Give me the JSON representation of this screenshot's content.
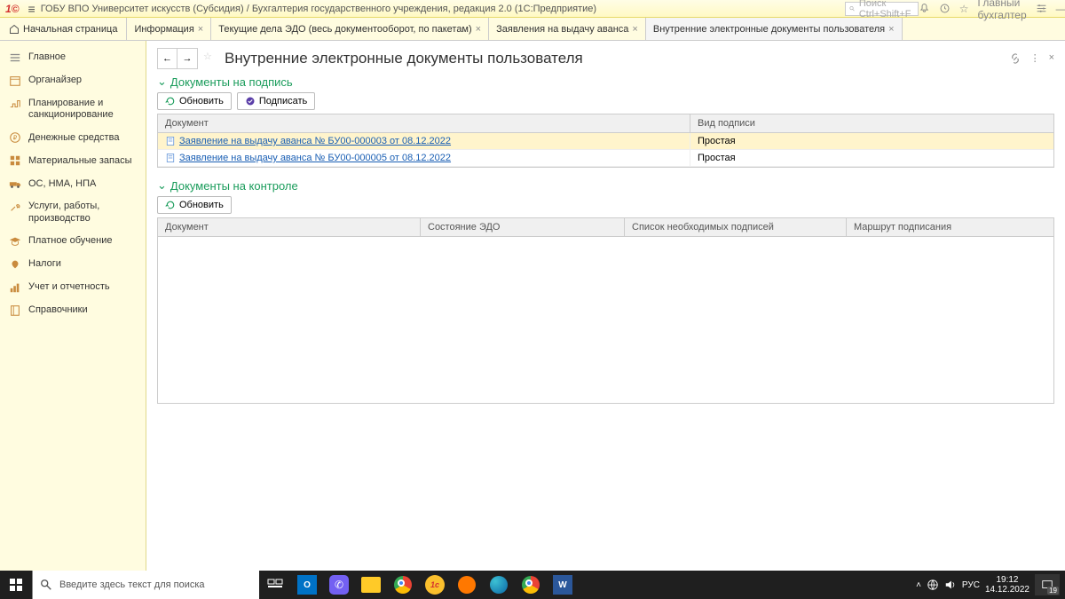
{
  "titlebar": {
    "logo": "1©",
    "title": "ГОБУ ВПО Университет искусств (Субсидия) / Бухгалтерия государственного учреждения, редакция 2.0  (1С:Предприятие)",
    "search_placeholder": "Поиск Ctrl+Shift+F",
    "user": "Главный бухгалтер"
  },
  "tabs": {
    "home": "Начальная страница",
    "items": [
      {
        "label": "Информация"
      },
      {
        "label": "Текущие дела ЭДО (весь документооборот, по пакетам)"
      },
      {
        "label": "Заявления на выдачу аванса"
      },
      {
        "label": "Внутренние электронные документы пользователя",
        "active": true
      }
    ]
  },
  "sidebar": {
    "items": [
      "Главное",
      "Органайзер",
      "Планирование и санкционирование",
      "Денежные средства",
      "Материальные запасы",
      "ОС, НМА, НПА",
      "Услуги, работы, производство",
      "Платное обучение",
      "Налоги",
      "Учет и отчетность",
      "Справочники"
    ]
  },
  "content": {
    "title": "Внутренние электронные документы пользователя",
    "section1": {
      "title": "Документы на подпись",
      "btn_refresh": "Обновить",
      "btn_sign": "Подписать",
      "col_doc": "Документ",
      "col_sig": "Вид подписи",
      "rows": [
        {
          "doc": "Заявление на выдачу аванса № БУ00-000003 от 08.12.2022",
          "sig": "Простая"
        },
        {
          "doc": "Заявление на выдачу аванса № БУ00-000005 от 08.12.2022",
          "sig": "Простая"
        }
      ]
    },
    "section2": {
      "title": "Документы на контроле",
      "btn_refresh": "Обновить",
      "col1": "Документ",
      "col2": "Состояние ЭДО",
      "col3": "Список необходимых подписей",
      "col4": "Маршрут подписания"
    }
  },
  "taskbar": {
    "search_placeholder": "Введите здесь текст для поиска",
    "lang": "РУС",
    "time": "19:12",
    "date": "14.12.2022",
    "notif_count": "19"
  }
}
